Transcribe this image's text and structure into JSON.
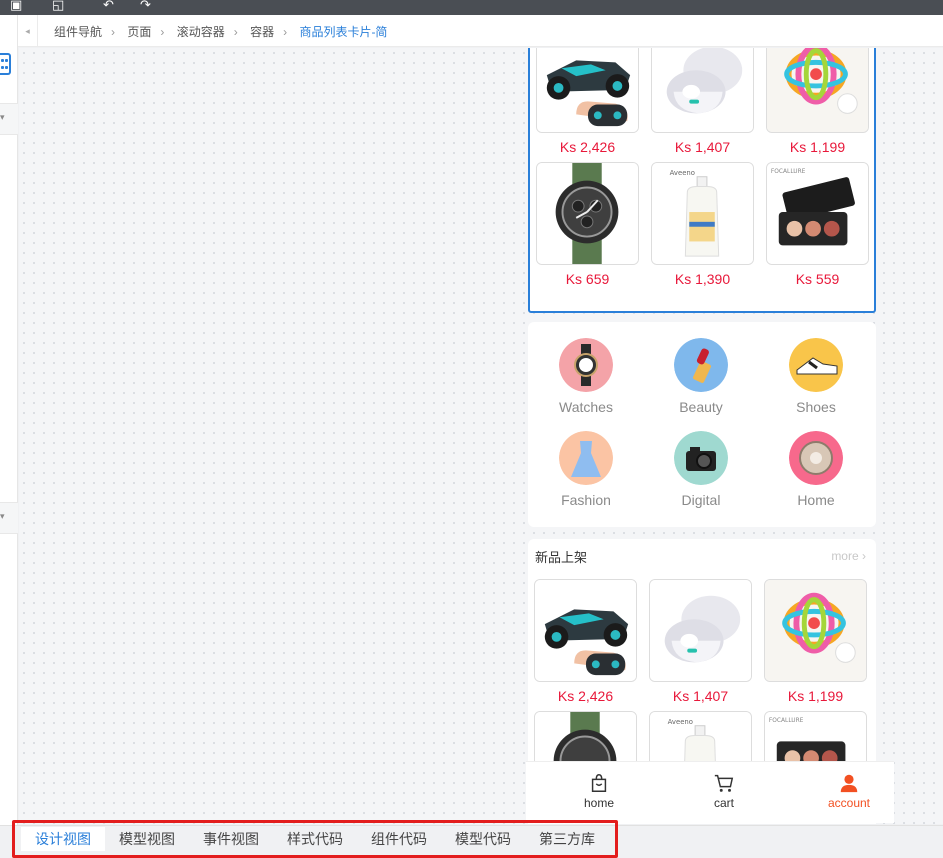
{
  "breadcrumb": [
    "组件导航",
    "页面",
    "滚动容器",
    "容器",
    "商品列表卡片-简"
  ],
  "products_top": [
    {
      "price": "Ks 2,426",
      "icon": "rc-car"
    },
    {
      "price": "Ks 1,407",
      "icon": "earbuds"
    },
    {
      "price": "Ks 1,199",
      "icon": "baby-toy"
    },
    {
      "price": "Ks 659",
      "icon": "watch"
    },
    {
      "price": "Ks 1,390",
      "icon": "lotion"
    },
    {
      "price": "Ks 559",
      "icon": "eyeshadow"
    }
  ],
  "categories": [
    {
      "label": "Watches",
      "icon": "watch-icon",
      "color": "#f4a3a8"
    },
    {
      "label": "Beauty",
      "icon": "lipstick-icon",
      "color": "#7fb8ec"
    },
    {
      "label": "Shoes",
      "icon": "shoe-icon",
      "color": "#f9c54a"
    },
    {
      "label": "Fashion",
      "icon": "dress-icon",
      "color": "#fbc4a4"
    },
    {
      "label": "Digital",
      "icon": "camera-icon",
      "color": "#9fd9d0"
    },
    {
      "label": "Home",
      "icon": "robot-vacuum-icon",
      "color": "#f7698c"
    }
  ],
  "new_arrivals": {
    "title": "新品上架",
    "more": "more",
    "products": [
      {
        "price": "Ks 2,426"
      },
      {
        "price": "Ks 1,407"
      },
      {
        "price": "Ks 1,199"
      }
    ]
  },
  "tabbar": [
    {
      "label": "home",
      "icon": "shopping-bag-icon"
    },
    {
      "label": "cart",
      "icon": "cart-icon"
    },
    {
      "label": "account",
      "icon": "user-icon",
      "active": true
    }
  ],
  "view_tabs": [
    "设计视图",
    "模型视图",
    "事件视图",
    "样式代码",
    "组件代码",
    "模型代码",
    "第三方库"
  ],
  "colors": {
    "accent": "#2a7fd9",
    "price": "#e8183a",
    "active_tab": "#f25022",
    "highlight_box": "#e31d1d"
  }
}
